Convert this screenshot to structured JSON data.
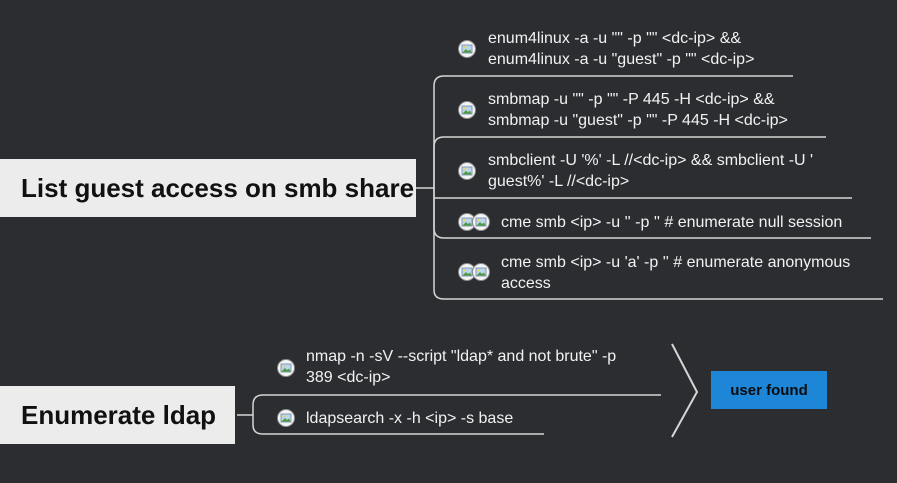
{
  "groups": [
    {
      "title": "List guest access on smb share",
      "items": [
        {
          "line1": "enum4linux -a -u \"\" -p \"\" <dc-ip> &&",
          "line2": "enum4linux -a -u \"guest\" -p \"\" <dc-ip>"
        },
        {
          "line1": "smbmap -u \"\" -p \"\" -P 445 -H <dc-ip> &&",
          "line2": "smbmap -u \"guest\" -p \"\" -P 445 -H <dc-ip>"
        },
        {
          "line1": "smbclient -U '%' -L //<dc-ip> && smbclient -U '",
          "line2": "guest%' -L //<dc-ip>"
        },
        {
          "line1": "cme smb <ip> -u '' -p '' # enumerate null session"
        },
        {
          "line1": "cme smb <ip> -u 'a' -p '' # enumerate anonymous",
          "line2": "access"
        }
      ]
    },
    {
      "title": "Enumerate ldap",
      "items": [
        {
          "line1": "nmap -n -sV --script \"ldap* and not brute\" -p",
          "line2": "389 <dc-ip>"
        },
        {
          "line1": "ldapsearch -x -h <ip> -s base"
        }
      ],
      "result": "user found"
    }
  ],
  "colors": {
    "background": "#2b2d30",
    "root_bg": "#ececec",
    "result_bg": "#1e86d6",
    "line": "#d9d9d9"
  },
  "icons": [
    "image-icon"
  ]
}
